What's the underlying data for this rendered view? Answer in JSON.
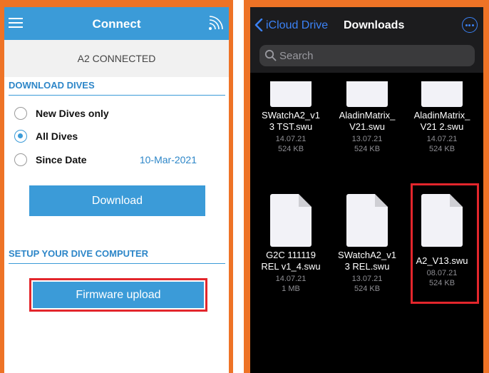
{
  "left": {
    "header": {
      "title": "Connect"
    },
    "status": "A2 CONNECTED",
    "download_section": {
      "title": "DOWNLOAD DIVES",
      "options": [
        {
          "label": "New Dives only",
          "selected": false
        },
        {
          "label": "All Dives",
          "selected": true
        },
        {
          "label": "Since Date",
          "selected": false
        }
      ],
      "since_date_value": "10-Mar-2021",
      "button": "Download"
    },
    "setup_section": {
      "title": "SETUP YOUR DIVE COMPUTER",
      "button": "Firmware upload"
    }
  },
  "right": {
    "nav": {
      "back_label": "iCloud Drive",
      "title": "Downloads"
    },
    "search": {
      "placeholder": "Search"
    },
    "files_row1": [
      {
        "name1": "SWatchA2_v1",
        "name2": "3 TST.swu",
        "date": "14.07.21",
        "size": "524 KB"
      },
      {
        "name1": "AladinMatrix_",
        "name2": "V21.swu",
        "date": "13.07.21",
        "size": "524 KB"
      },
      {
        "name1": "AladinMatrix_",
        "name2": "V21 2.swu",
        "date": "14.07.21",
        "size": "524 KB"
      }
    ],
    "files_row2": [
      {
        "name1": "G2C 111119",
        "name2": "REL v1_4.swu",
        "date": "14.07.21",
        "size": "1 MB"
      },
      {
        "name1": "SWatchA2_v1",
        "name2": "3 REL.swu",
        "date": "13.07.21",
        "size": "524 KB"
      },
      {
        "name1": "A2_V13.swu",
        "name2": "",
        "date": "08.07.21",
        "size": "524 KB"
      }
    ]
  },
  "colors": {
    "frame": "#ee7326",
    "accent_blue": "#3b9bd8",
    "highlight_red": "#e3262c",
    "ios_blue": "#3b82f6"
  }
}
